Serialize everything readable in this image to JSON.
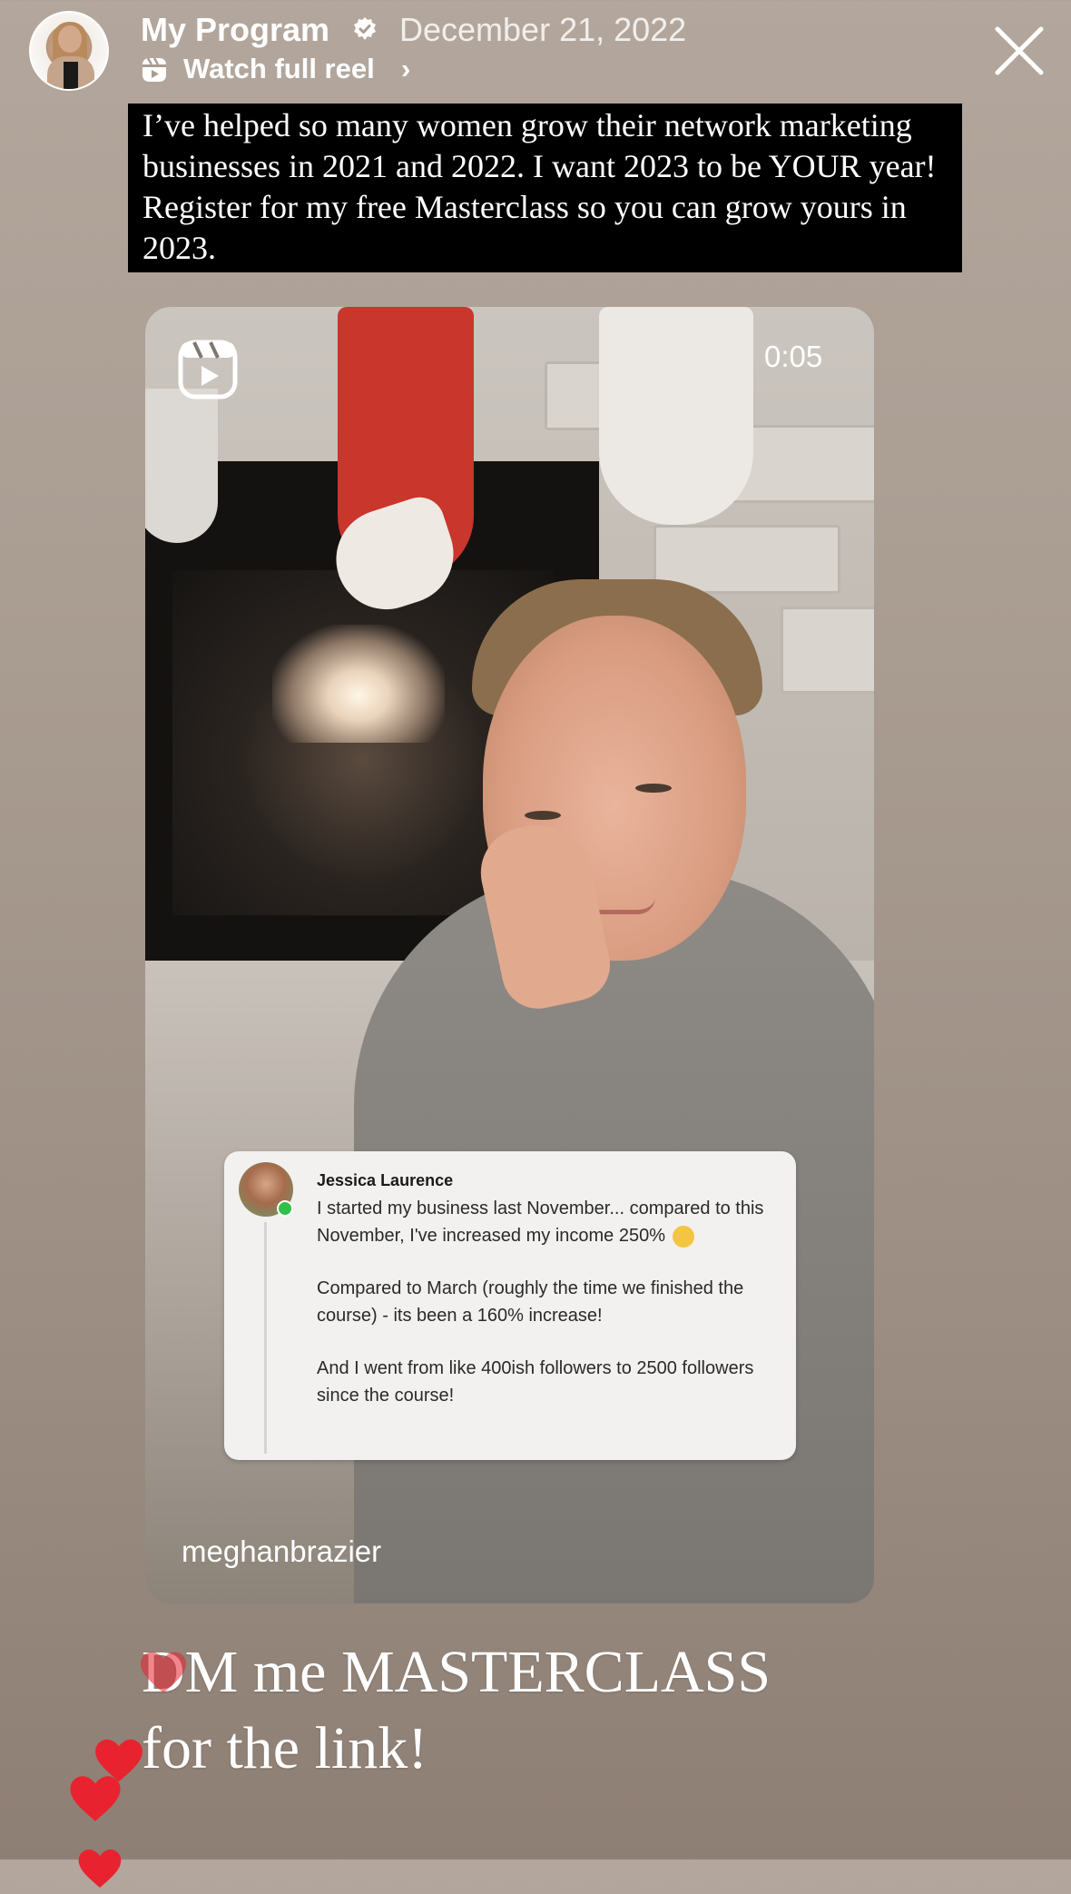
{
  "header": {
    "account_name": "My Program",
    "date": "December 21, 2022",
    "watch_label": "Watch full reel",
    "watch_chevron": "›",
    "verified_icon": "verified-badge-icon",
    "close_icon": "close-icon"
  },
  "caption": "I’ve helped so many women grow their network marketing businesses in 2021 and 2022. I want 2023 to be YOUR year! Register for my free Masterclass so you can grow yours in 2023.",
  "video": {
    "timer": "0:05",
    "username": "meghanbrazier",
    "reel_icon": "reels-icon",
    "comment": {
      "author": "Jessica Laurence",
      "line1": "I started my business last November... compared to this November, I've increased my income 250%",
      "line2": "Compared to March (roughly the time we finished the course) - its been a 160% increase!",
      "line3": "And I went from like 400ish followers to 2500 followers since the course!"
    }
  },
  "cta": {
    "line1": "DM me MASTERCLASS",
    "line2": "for the link!"
  },
  "colors": {
    "background": "#a99c91",
    "caption_bg": "#000000",
    "heart": "#e8232f",
    "online": "#2fbf4a"
  }
}
